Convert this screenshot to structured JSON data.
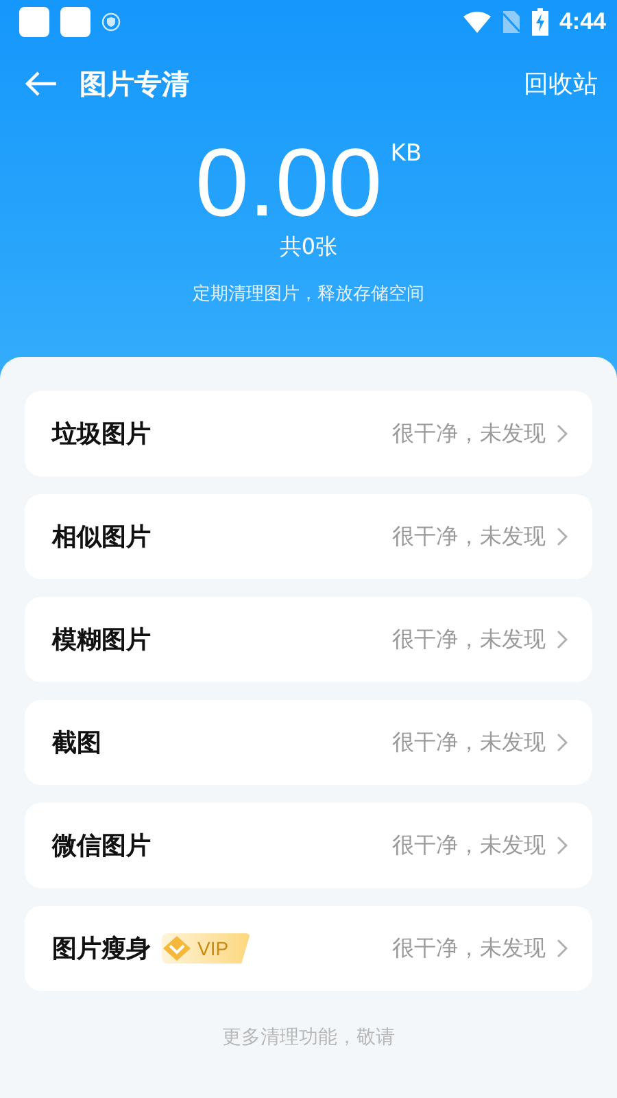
{
  "status_bar": {
    "time": "4:44"
  },
  "header": {
    "title": "图片专清",
    "action": "回收站"
  },
  "summary": {
    "size": "0.00",
    "unit": "KB",
    "count": "共0张",
    "hint": "定期清理图片，释放存储空间"
  },
  "items": [
    {
      "label": "垃圾图片",
      "status": "很干净，未发现"
    },
    {
      "label": "相似图片",
      "status": "很干净，未发现"
    },
    {
      "label": "模糊图片",
      "status": "很干净，未发现"
    },
    {
      "label": "截图",
      "status": "很干净，未发现"
    },
    {
      "label": "微信图片",
      "status": "很干净，未发现"
    },
    {
      "label": "图片瘦身",
      "status": "很干净，未发现",
      "badge": "VIP"
    }
  ],
  "footer": "更多清理功能，敬请"
}
